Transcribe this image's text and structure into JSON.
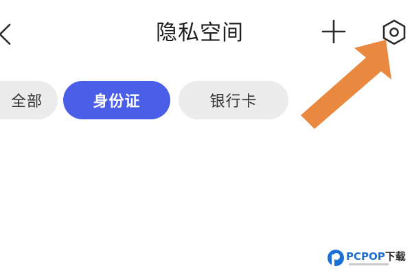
{
  "header": {
    "title": "隐私空间",
    "back_icon": "chevron-left-icon",
    "add_icon": "plus-icon",
    "settings_icon": "hexagon-settings-icon"
  },
  "tabs": [
    {
      "label": "全部",
      "selected": false
    },
    {
      "label": "身份证",
      "selected": true
    },
    {
      "label": "银行卡",
      "selected": false
    }
  ],
  "colors": {
    "selected_tab": "#4a5ee8",
    "unselected_tab": "#ececec",
    "annotation_arrow": "#e8893f"
  },
  "watermark": {
    "brand_prefix": "PCPOP",
    "brand_suffix": "下载"
  }
}
